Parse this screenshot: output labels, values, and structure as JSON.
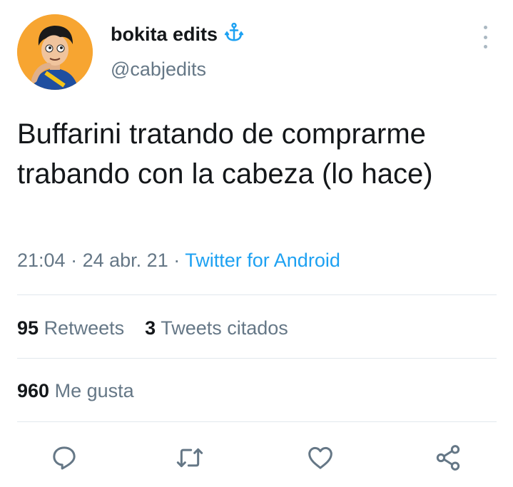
{
  "author": {
    "display_name": "bokita edits",
    "handle": "@cabjedits",
    "badge_icon": "anchor-icon"
  },
  "tweet": {
    "text": "Buffarini tratando de comprarme trabando con la cabeza (lo hace)",
    "time": "21:04",
    "date": "24 abr. 21",
    "source": "Twitter for Android",
    "separator": "·"
  },
  "stats": {
    "retweets_count": "95",
    "retweets_label": "Retweets",
    "quotes_count": "3",
    "quotes_label": "Tweets citados",
    "likes_count": "960",
    "likes_label": "Me gusta"
  },
  "actions": [
    "reply-icon",
    "retweet-icon",
    "like-icon",
    "share-icon"
  ],
  "colors": {
    "accent": "#1da1f2",
    "text": "#14171a",
    "muted": "#657786",
    "divider": "#e1e8ed",
    "avatar_bg": "#f7a531"
  }
}
